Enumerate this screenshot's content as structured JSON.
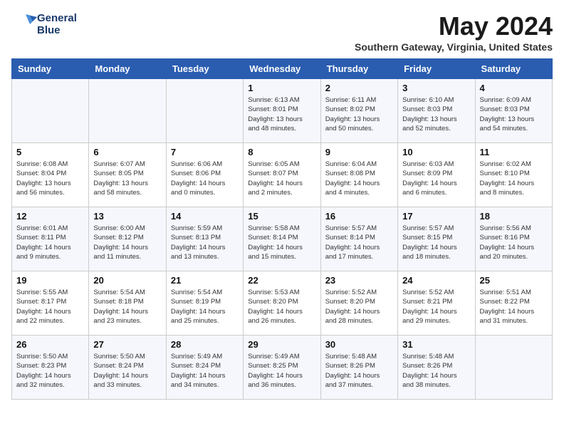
{
  "header": {
    "logo_line1": "General",
    "logo_line2": "Blue",
    "month": "May 2024",
    "location": "Southern Gateway, Virginia, United States"
  },
  "weekdays": [
    "Sunday",
    "Monday",
    "Tuesday",
    "Wednesday",
    "Thursday",
    "Friday",
    "Saturday"
  ],
  "weeks": [
    [
      {
        "day": "",
        "info": ""
      },
      {
        "day": "",
        "info": ""
      },
      {
        "day": "",
        "info": ""
      },
      {
        "day": "1",
        "info": "Sunrise: 6:13 AM\nSunset: 8:01 PM\nDaylight: 13 hours\nand 48 minutes."
      },
      {
        "day": "2",
        "info": "Sunrise: 6:11 AM\nSunset: 8:02 PM\nDaylight: 13 hours\nand 50 minutes."
      },
      {
        "day": "3",
        "info": "Sunrise: 6:10 AM\nSunset: 8:03 PM\nDaylight: 13 hours\nand 52 minutes."
      },
      {
        "day": "4",
        "info": "Sunrise: 6:09 AM\nSunset: 8:03 PM\nDaylight: 13 hours\nand 54 minutes."
      }
    ],
    [
      {
        "day": "5",
        "info": "Sunrise: 6:08 AM\nSunset: 8:04 PM\nDaylight: 13 hours\nand 56 minutes."
      },
      {
        "day": "6",
        "info": "Sunrise: 6:07 AM\nSunset: 8:05 PM\nDaylight: 13 hours\nand 58 minutes."
      },
      {
        "day": "7",
        "info": "Sunrise: 6:06 AM\nSunset: 8:06 PM\nDaylight: 14 hours\nand 0 minutes."
      },
      {
        "day": "8",
        "info": "Sunrise: 6:05 AM\nSunset: 8:07 PM\nDaylight: 14 hours\nand 2 minutes."
      },
      {
        "day": "9",
        "info": "Sunrise: 6:04 AM\nSunset: 8:08 PM\nDaylight: 14 hours\nand 4 minutes."
      },
      {
        "day": "10",
        "info": "Sunrise: 6:03 AM\nSunset: 8:09 PM\nDaylight: 14 hours\nand 6 minutes."
      },
      {
        "day": "11",
        "info": "Sunrise: 6:02 AM\nSunset: 8:10 PM\nDaylight: 14 hours\nand 8 minutes."
      }
    ],
    [
      {
        "day": "12",
        "info": "Sunrise: 6:01 AM\nSunset: 8:11 PM\nDaylight: 14 hours\nand 9 minutes."
      },
      {
        "day": "13",
        "info": "Sunrise: 6:00 AM\nSunset: 8:12 PM\nDaylight: 14 hours\nand 11 minutes."
      },
      {
        "day": "14",
        "info": "Sunrise: 5:59 AM\nSunset: 8:13 PM\nDaylight: 14 hours\nand 13 minutes."
      },
      {
        "day": "15",
        "info": "Sunrise: 5:58 AM\nSunset: 8:14 PM\nDaylight: 14 hours\nand 15 minutes."
      },
      {
        "day": "16",
        "info": "Sunrise: 5:57 AM\nSunset: 8:14 PM\nDaylight: 14 hours\nand 17 minutes."
      },
      {
        "day": "17",
        "info": "Sunrise: 5:57 AM\nSunset: 8:15 PM\nDaylight: 14 hours\nand 18 minutes."
      },
      {
        "day": "18",
        "info": "Sunrise: 5:56 AM\nSunset: 8:16 PM\nDaylight: 14 hours\nand 20 minutes."
      }
    ],
    [
      {
        "day": "19",
        "info": "Sunrise: 5:55 AM\nSunset: 8:17 PM\nDaylight: 14 hours\nand 22 minutes."
      },
      {
        "day": "20",
        "info": "Sunrise: 5:54 AM\nSunset: 8:18 PM\nDaylight: 14 hours\nand 23 minutes."
      },
      {
        "day": "21",
        "info": "Sunrise: 5:54 AM\nSunset: 8:19 PM\nDaylight: 14 hours\nand 25 minutes."
      },
      {
        "day": "22",
        "info": "Sunrise: 5:53 AM\nSunset: 8:20 PM\nDaylight: 14 hours\nand 26 minutes."
      },
      {
        "day": "23",
        "info": "Sunrise: 5:52 AM\nSunset: 8:20 PM\nDaylight: 14 hours\nand 28 minutes."
      },
      {
        "day": "24",
        "info": "Sunrise: 5:52 AM\nSunset: 8:21 PM\nDaylight: 14 hours\nand 29 minutes."
      },
      {
        "day": "25",
        "info": "Sunrise: 5:51 AM\nSunset: 8:22 PM\nDaylight: 14 hours\nand 31 minutes."
      }
    ],
    [
      {
        "day": "26",
        "info": "Sunrise: 5:50 AM\nSunset: 8:23 PM\nDaylight: 14 hours\nand 32 minutes."
      },
      {
        "day": "27",
        "info": "Sunrise: 5:50 AM\nSunset: 8:24 PM\nDaylight: 14 hours\nand 33 minutes."
      },
      {
        "day": "28",
        "info": "Sunrise: 5:49 AM\nSunset: 8:24 PM\nDaylight: 14 hours\nand 34 minutes."
      },
      {
        "day": "29",
        "info": "Sunrise: 5:49 AM\nSunset: 8:25 PM\nDaylight: 14 hours\nand 36 minutes."
      },
      {
        "day": "30",
        "info": "Sunrise: 5:48 AM\nSunset: 8:26 PM\nDaylight: 14 hours\nand 37 minutes."
      },
      {
        "day": "31",
        "info": "Sunrise: 5:48 AM\nSunset: 8:26 PM\nDaylight: 14 hours\nand 38 minutes."
      },
      {
        "day": "",
        "info": ""
      }
    ]
  ]
}
